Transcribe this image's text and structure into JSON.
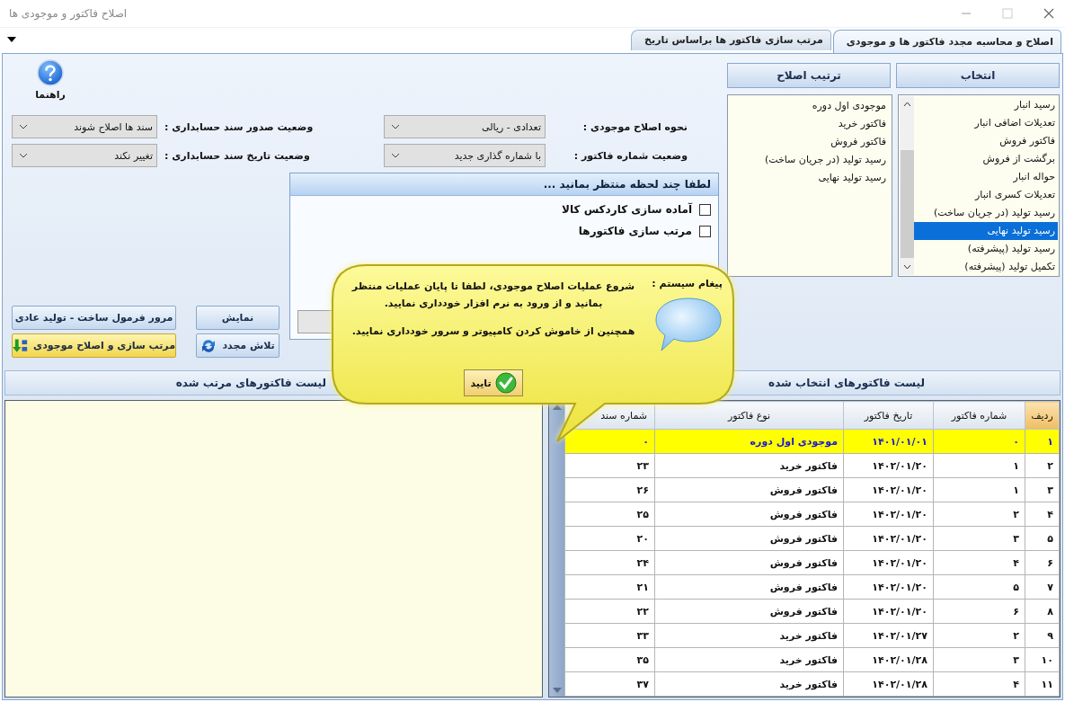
{
  "window": {
    "title": "اصلاح فاکتور و موجودی ها"
  },
  "tabs": [
    {
      "label": "اصلاح و محاسبه مجدد فاکتور ها و موجودی",
      "selected": true
    },
    {
      "label": "مرتب سازی فاکتور ها براساس تاریخ",
      "selected": false
    }
  ],
  "help": {
    "label": "راهنما"
  },
  "settings": [
    {
      "label": "نحوه اصلاح موجودی :",
      "value": "تعدادی - ریالی"
    },
    {
      "label": "وضعیت صدور سند حسابداری :",
      "value": "سند ها اصلاح شوند"
    },
    {
      "label": "وضعیت شماره فاکتور :",
      "value": "با شماره گذاری جدید"
    },
    {
      "label": "وضعیت تاریخ سند حسابداری :",
      "value": "تغییر نکند"
    }
  ],
  "buttons": [
    {
      "label": "نمایش",
      "kind": "plain"
    },
    {
      "label": "مرور فرمول ساخت - تولید عادی",
      "kind": "plain"
    },
    {
      "label": "تلاش مجدد",
      "kind": "retry"
    },
    {
      "label": "مرتب سازی و اصلاح موجودی",
      "kind": "sort"
    }
  ],
  "selection_panel": {
    "header": "انتخاب",
    "items": [
      {
        "label": "رسید انبار",
        "selected": false
      },
      {
        "label": "تعدیلات اضافی انبار",
        "selected": false
      },
      {
        "label": "فاکتور فروش",
        "selected": false
      },
      {
        "label": "برگشت از فروش",
        "selected": false
      },
      {
        "label": "حواله انبار",
        "selected": false
      },
      {
        "label": "تعدیلات کسری انبار",
        "selected": false
      },
      {
        "label": "رسید تولید (در جریان ساخت)",
        "selected": false
      },
      {
        "label": "رسید تولید نهایی",
        "selected": true
      },
      {
        "label": "رسید تولید (پیشرفته)",
        "selected": false
      },
      {
        "label": "تکمیل تولید (پیشرفته)",
        "selected": false
      }
    ]
  },
  "order_panel": {
    "header": "ترتیب اصلاح",
    "items": [
      "موجودی اول دوره",
      "فاکتور خرید",
      "فاکتور فروش",
      "رسید تولید (در جریان ساخت)",
      "رسید تولید نهایی"
    ]
  },
  "progress_dialog": {
    "title": "لطفا چند لحظه منتظر بمانید ...",
    "steps": [
      {
        "label": "آماده سازی کاردکس کالا",
        "checked": false
      },
      {
        "label": "مرتب سازی فاکتورها",
        "checked": false
      }
    ],
    "progress": {
      "level": 0
    }
  },
  "sorted_list": {
    "header": "لیست فاکتورهای مرتب شده"
  },
  "selected_list": {
    "header": "لیست فاکتورهای انتخاب شده",
    "columns": [
      "ردیف",
      "شماره فاکتور",
      "تاریخ فاکتور",
      "نوع فاکتور",
      "شماره سند"
    ],
    "rows": [
      {
        "cells": [
          "۱",
          "۰",
          "۱۴۰۱/۰۱/۰۱",
          "موجودی اول دوره",
          "۰"
        ],
        "selected": true
      },
      {
        "cells": [
          "۲",
          "۱",
          "۱۴۰۲/۰۱/۲۰",
          "فاکتور خرید",
          "۲۳"
        ],
        "selected": false
      },
      {
        "cells": [
          "۳",
          "۱",
          "۱۴۰۲/۰۱/۲۰",
          "فاکتور فروش",
          "۲۶"
        ],
        "selected": false
      },
      {
        "cells": [
          "۴",
          "۲",
          "۱۴۰۲/۰۱/۲۰",
          "فاکتور فروش",
          "۲۵"
        ],
        "selected": false
      },
      {
        "cells": [
          "۵",
          "۳",
          "۱۴۰۲/۰۱/۲۰",
          "فاکتور فروش",
          "۲۰"
        ],
        "selected": false
      },
      {
        "cells": [
          "۶",
          "۴",
          "۱۴۰۲/۰۱/۲۰",
          "فاکتور فروش",
          "۲۴"
        ],
        "selected": false
      },
      {
        "cells": [
          "۷",
          "۵",
          "۱۴۰۲/۰۱/۲۰",
          "فاکتور فروش",
          "۲۱"
        ],
        "selected": false
      },
      {
        "cells": [
          "۸",
          "۶",
          "۱۴۰۲/۰۱/۲۰",
          "فاکتور فروش",
          "۲۲"
        ],
        "selected": false
      },
      {
        "cells": [
          "۹",
          "۲",
          "۱۴۰۲/۰۱/۲۷",
          "فاکتور خرید",
          "۳۳"
        ],
        "selected": false
      },
      {
        "cells": [
          "۱۰",
          "۳",
          "۱۴۰۲/۰۱/۲۸",
          "فاکتور خرید",
          "۳۵"
        ],
        "selected": false
      },
      {
        "cells": [
          "۱۱",
          "۴",
          "۱۴۰۲/۰۱/۲۸",
          "فاکتور خرید",
          "۳۷"
        ],
        "selected": false
      }
    ]
  },
  "message": {
    "caption": "پیغام سیستم :",
    "paragraphs": [
      "شروع عملیات اصلاح موجودی، لطفا تا پایان عملیات منتظر بمانید و از ورود به نرم افزار خودداری نمایید.",
      "همچنین از خاموش کردن کامپیوتر و سرور خودداری نمایید."
    ],
    "button": "تایید"
  }
}
